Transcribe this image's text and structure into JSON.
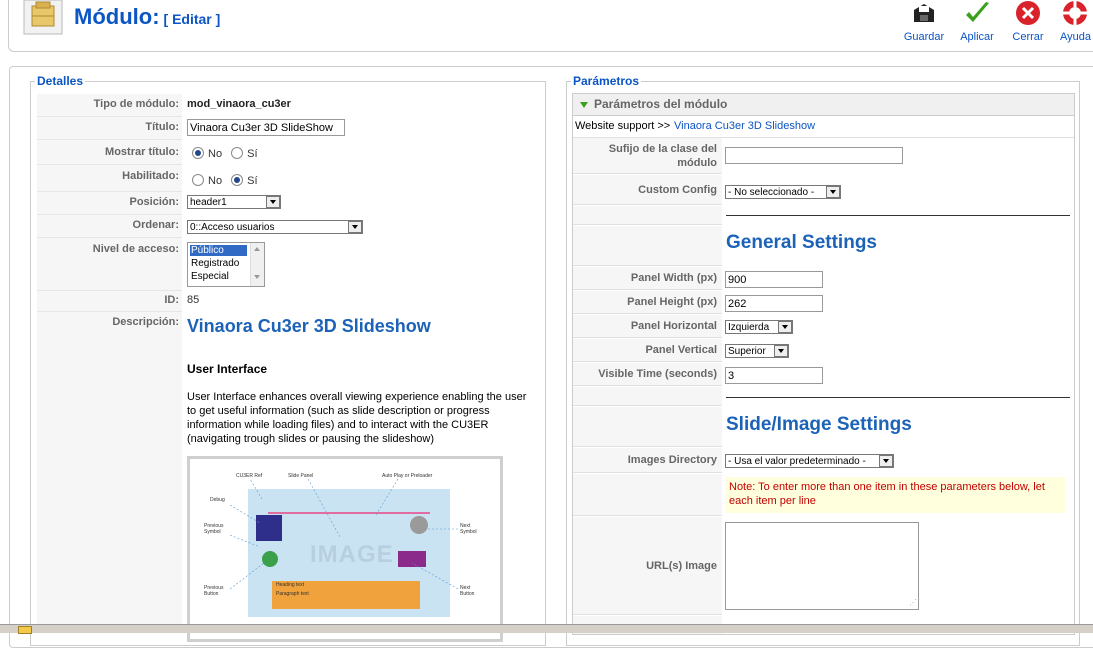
{
  "header": {
    "title": "Módulo:",
    "subtitle": "[ Editar ]",
    "toolbar": {
      "save": "Guardar",
      "apply": "Aplicar",
      "close": "Cerrar",
      "help": "Ayuda"
    }
  },
  "details": {
    "legend": "Detalles",
    "module_type_label": "Tipo de módulo:",
    "module_type_value": "mod_vinaora_cu3er",
    "title_label": "Título:",
    "title_value": "Vinaora Cu3er 3D SlideShow",
    "show_title_label": "Mostrar título:",
    "show_title_no": "No",
    "show_title_yes": "Sí",
    "enabled_label": "Habilitado:",
    "enabled_no": "No",
    "enabled_yes": "Sí",
    "position_label": "Posición:",
    "position_value": "header1",
    "order_label": "Ordenar:",
    "order_value": "0::Acceso usuarios",
    "access_label": "Nivel de acceso:",
    "access_options": [
      "Público",
      "Registrado",
      "Especial"
    ],
    "id_label": "ID:",
    "id_value": "85",
    "desc_label": "Descripción:",
    "desc_title": "Vinaora Cu3er 3D Slideshow",
    "desc_subtitle": "User Interface",
    "desc_text": "User Interface enhances overall viewing experience enabling the user to get useful information (such as slide description or progress information while loading files) and to interact with the CU3ER (navigating trough slides or pausing the slideshow)",
    "diagram": {
      "center_text": "IMAGE",
      "labels": [
        "CU3ER Ref",
        "Slide Panel",
        "Auto Play or Preloader",
        "Debug",
        "Previous Symbol",
        "Next Symbol",
        "Previous Button",
        "Next Button",
        "Heading text",
        "Paragraph text"
      ]
    }
  },
  "params": {
    "legend": "Parámetros",
    "panel_title": "Parámetros del módulo",
    "support_prefix": "Website support >>",
    "support_link": "Vinaora Cu3er 3D Slideshow",
    "class_suffix_label_1": "Sufijo de la clase del",
    "class_suffix_label_2": "módulo",
    "class_suffix_value": "",
    "custom_config_label": "Custom Config",
    "custom_config_value": "- No seleccionado -",
    "general_settings": "General Settings",
    "panel_width_label": "Panel Width (px)",
    "panel_width_value": "900",
    "panel_height_label": "Panel Height (px)",
    "panel_height_value": "262",
    "panel_h_label": "Panel Horizontal",
    "panel_h_value": "Izquierda",
    "panel_v_label": "Panel Vertical",
    "panel_v_value": "Superior",
    "visible_time_label": "Visible Time (seconds)",
    "visible_time_value": "3",
    "slide_settings": "Slide/Image Settings",
    "images_dir_label": "Images Directory",
    "images_dir_value": "- Usa el valor predeterminado -",
    "note": "Note: To enter more than one item in these parameters below, let each item per line",
    "url_image_label": "URL(s) Image"
  },
  "colors": {
    "accent": "#0b55c4",
    "heading": "#1c63b8",
    "note_bg": "#ffffdd",
    "note_text": "#c00000"
  }
}
